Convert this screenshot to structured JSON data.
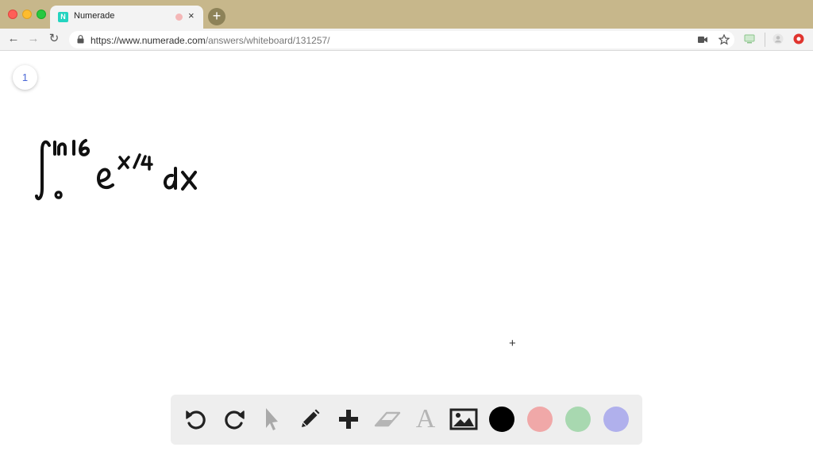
{
  "browser": {
    "tab": {
      "title": "Numerade",
      "favicon_letter": "N",
      "close_glyph": "×"
    },
    "new_tab_glyph": "+",
    "url": {
      "host": "https://www.numerade.com",
      "path": "/answers/whiteboard/131257/"
    },
    "nav": {
      "back_glyph": "←",
      "forward_glyph": "→",
      "reload_glyph": "↻"
    },
    "icons": [
      "video-camera-icon",
      "star-icon",
      "screen-cast-icon",
      "profile-icon",
      "extension-icon"
    ]
  },
  "whiteboard": {
    "page_number": "1",
    "cursor_glyph": "+",
    "handwritten_expression": {
      "integral_upper": "ln16",
      "integral_lower": "0",
      "base": "e",
      "exponent": "x/4",
      "differential": "dx"
    }
  },
  "toolbar": {
    "tools": [
      {
        "name": "undo-icon",
        "enabled": true
      },
      {
        "name": "redo-icon",
        "enabled": true
      },
      {
        "name": "select-pointer-icon",
        "enabled": false
      },
      {
        "name": "pencil-icon",
        "enabled": true
      },
      {
        "name": "add-icon",
        "enabled": true
      },
      {
        "name": "eraser-icon",
        "enabled": false
      },
      {
        "name": "text-tool-icon",
        "enabled": false,
        "glyph": "A"
      },
      {
        "name": "image-icon",
        "enabled": true
      }
    ],
    "colors": [
      "#000000",
      "#f0a8a8",
      "#a8d8b0",
      "#b0b0ec"
    ]
  }
}
